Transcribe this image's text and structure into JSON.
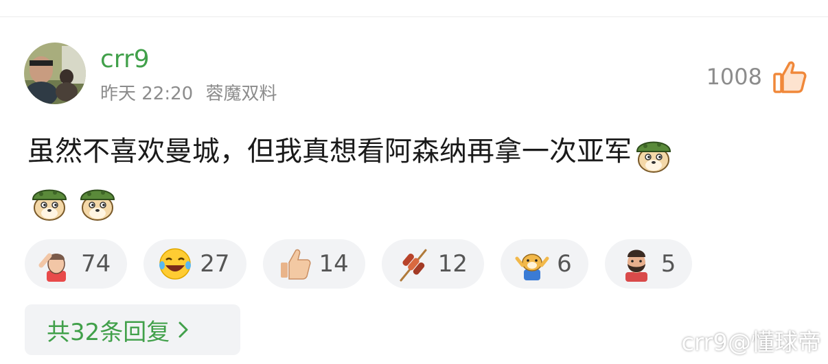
{
  "comment": {
    "author": "crr9",
    "timestamp": "昨天 22:20",
    "device": "蓉魔双料",
    "likes": "1008",
    "text": "虽然不喜欢曼城，但我真想看阿森纳再拿一次亚军",
    "emojis": [
      "soldier-doge-icon",
      "soldier-doge-icon",
      "soldier-doge-icon"
    ]
  },
  "reactions": [
    {
      "icon": "salute-man-icon",
      "count": "74"
    },
    {
      "icon": "laughing-tears-icon",
      "count": "27"
    },
    {
      "icon": "thumbs-up-icon",
      "count": "14"
    },
    {
      "icon": "skewer-icon",
      "count": "12"
    },
    {
      "icon": "cheering-doge-icon",
      "count": "6"
    },
    {
      "icon": "bearded-man-icon",
      "count": "5"
    }
  ],
  "replies": {
    "label": "共32条回复"
  },
  "watermark": "crr9@懂球帝",
  "colors": {
    "accent_green": "#41a04a",
    "like_orange": "#f0883a",
    "pill_bg": "#f2f3f5",
    "muted_text": "#8c8c8c"
  }
}
